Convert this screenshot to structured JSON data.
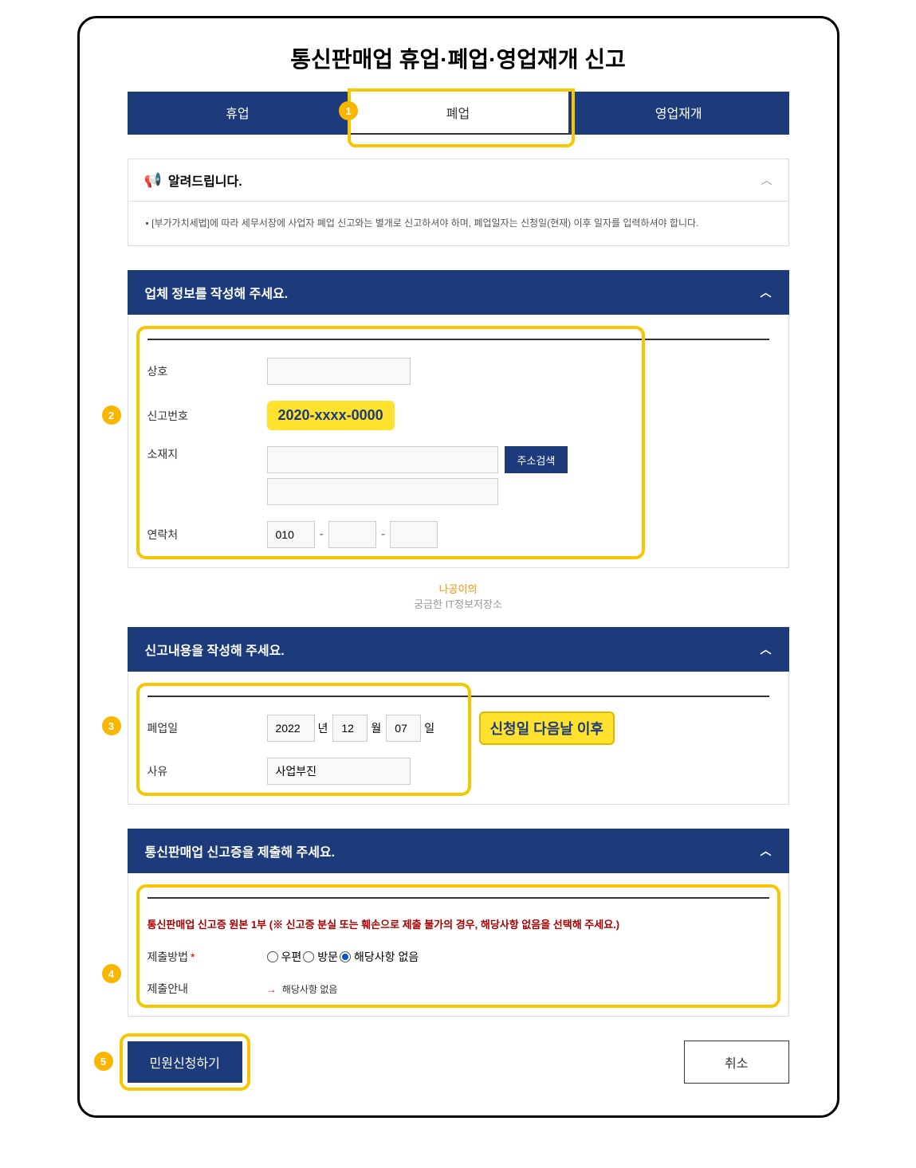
{
  "page_title": "통신판매업 휴업·폐업·영업재개 신고",
  "tabs": {
    "suspend": "휴업",
    "close": "폐업",
    "resume": "영업재개"
  },
  "notice": {
    "title": "알려드립니다.",
    "body": "[부가가치세법]에 따라 세무서장에 사업자 폐업 신고와는 별개로 신고하셔야 하며, 폐업일자는 신청일(현재) 이후 일자를 입력하셔야 합니다."
  },
  "section1_header": "업체 정보를 작성해 주세요.",
  "company": {
    "label_name": "상호",
    "label_regno": "신고번호",
    "regno_badge": "2020-xxxx-0000",
    "label_addr": "소재지",
    "addr_btn": "주소검색",
    "label_phone": "연락처",
    "phone1": "010"
  },
  "watermark_line1": "나공이의",
  "watermark_line2": "궁금한 IT정보저장소",
  "section2_header": "신고내용을 작성해 주세요.",
  "report": {
    "label_closedate": "폐업일",
    "year": "2022",
    "year_unit": "년",
    "month": "12",
    "month_unit": "월",
    "day": "07",
    "day_unit": "일",
    "note_badge": "신청일 다음날 이후",
    "label_reason": "사유",
    "reason_value": "사업부진"
  },
  "section3_header": "통신판매업 신고증을 제출해 주세요.",
  "cert": {
    "note": "통신판매업 신고증 원본 1부 (※ 신고증 분실 또는 훼손으로 제출 불가의 경우, 해당사항 없음을 선택해 주세요.)",
    "label_method": "제출방법",
    "radio_mail": "우편",
    "radio_visit": "방문",
    "radio_none": "해당사항 없음",
    "label_guide": "제출안내",
    "guide_text": "해당사항 없음"
  },
  "buttons": {
    "submit": "민원신청하기",
    "cancel": "취소"
  },
  "badges": {
    "b1": "1",
    "b2": "2",
    "b3": "3",
    "b4": "4",
    "b5": "5"
  },
  "bullet": "▪"
}
